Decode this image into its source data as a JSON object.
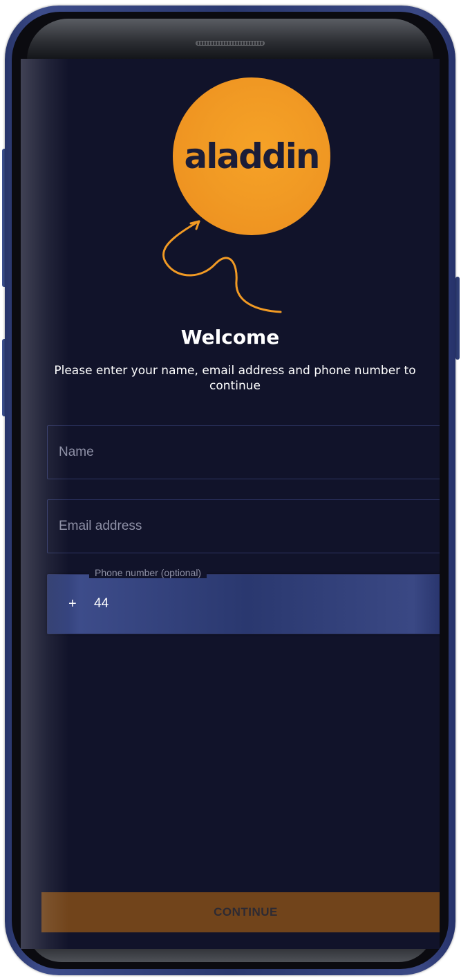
{
  "app": {
    "logo_text": "aladdin",
    "brand_color": "#f19a24",
    "background_color": "#11132a"
  },
  "welcome": {
    "title": "Welcome",
    "subtitle": "Please enter your name, email address and phone number to continue"
  },
  "form": {
    "name_placeholder": "Name",
    "email_placeholder": "Email address",
    "phone_label": "Phone number (optional)",
    "phone_prefix": "+",
    "phone_code": "44"
  },
  "actions": {
    "continue_label": "CONTINUE",
    "continue_color": "#71441b"
  }
}
